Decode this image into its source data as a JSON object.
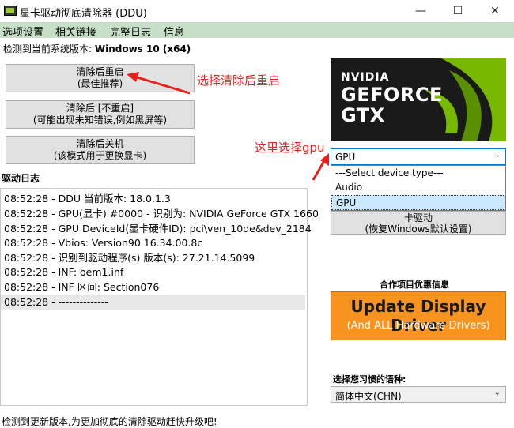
{
  "window": {
    "title": "显卡驱动彻底清除器 (DDU)",
    "minimize": "—",
    "maximize": "☐",
    "close": "✕"
  },
  "menu": [
    "选项设置",
    "相关链接",
    "完整日志",
    "信息"
  ],
  "version_label": "检测到当前系统版本: ",
  "version_value": "Windows 10 (x64)",
  "buttons": {
    "clean_restart": {
      "line1": "清除后重启",
      "line2": "(最佳推荐)"
    },
    "clean_no_restart": {
      "line1": "清除后 [不重启]",
      "line2": "(可能出现未知错误,例如黑屏等)"
    },
    "clean_shutdown": {
      "line1": "清除后关机",
      "line2": "(该模式用于更换显卡)"
    }
  },
  "annotations": {
    "restart_hint": "选择清除后重启",
    "gpu_hint": "这里选择gpu"
  },
  "log_label": "驱动日志",
  "log": [
    "08:52:28 - DDU 当前版本: 18.0.1.3",
    "08:52:28 - GPU(显卡) #0000 - 识别为: NVIDIA GeForce GTX 1660",
    "08:52:28 - GPU DeviceId(显卡硬件ID): pci\\ven_10de&dev_2184",
    "08:52:28 - Vbios: Version90 16.34.00.8c",
    "08:52:28 - 识别到驱动程序(s) 版本(s): 27.21.14.5099",
    "08:52:28 - INF: oem1.inf",
    "08:52:28 - INF 区间: Section076",
    "08:52:28 - --------------"
  ],
  "status": "检测到更新版本,为更加彻底的清除驱动赶快升级吧!",
  "logo": {
    "brand": "NVIDIA",
    "line1": "GEFORCE",
    "line2": "GTX"
  },
  "device_type": {
    "selected": "GPU",
    "options": [
      "---Select device type---",
      "Audio",
      "GPU"
    ]
  },
  "restore_button": {
    "line1": "卡驱动",
    "line2": "(恢复Windows默认设置)"
  },
  "promo": {
    "label": "合作项目优惠信息",
    "title": "Update Display Driver",
    "subtitle": "(And ALL Hardware Drivers)"
  },
  "language": {
    "label": "选择您习惯的语种:",
    "selected": "简体中文(CHN)"
  },
  "colors": {
    "menubar": "#c6dfc6",
    "annotation": "#e8201c",
    "promo": "#f7931e",
    "nvidia_green": "#76b900"
  }
}
